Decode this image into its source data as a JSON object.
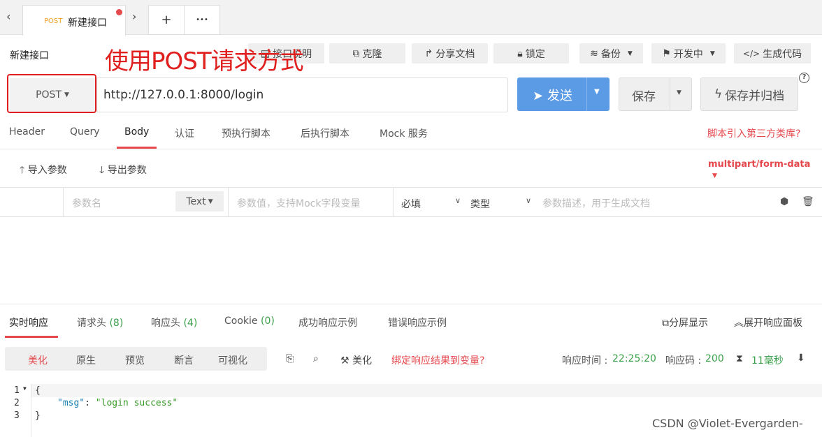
{
  "tabs": {
    "active": {
      "method": "POST",
      "title": "新建接口"
    },
    "add_label": "+",
    "more_label": "•••",
    "prev_label": "‹",
    "next_label": "›"
  },
  "toolbar": {
    "page_title": "新建接口",
    "doc_label": "接口说明",
    "clone_label": "克隆",
    "share_label": "分享文档",
    "lock_label": "锁定",
    "backup_label": "备份",
    "status_label": "开发中",
    "code_label": "生成代码"
  },
  "annotation": {
    "text": "使用POST请求方式",
    "color": "#e0201f"
  },
  "request": {
    "method": "POST",
    "url": "http://127.0.0.1:8000/login",
    "send_label": "发送",
    "save_label": "保存",
    "save_archive_label": "保存并归档",
    "help_label": "?"
  },
  "request_tabs": [
    "Header",
    "Query",
    "Body",
    "认证",
    "预执行脚本",
    "后执行脚本",
    "Mock 服务"
  ],
  "third_party_link": "脚本引入第三方类库?",
  "body": {
    "import_label": "导入参数",
    "export_label": "导出参数",
    "content_type": "multipart/form-data",
    "param": {
      "name_placeholder": "参数名",
      "type": "Text",
      "value_placeholder": "参数值，支持Mock字段变量",
      "required": "必填",
      "kind": "类型",
      "desc_placeholder": "参数描述，用于生成文档"
    }
  },
  "response_tabs": {
    "realtime": "实时响应",
    "req_headers": "请求头",
    "req_headers_count": "(8)",
    "res_headers": "响应头",
    "res_headers_count": "(4)",
    "cookie": "Cookie",
    "cookie_count": "(0)",
    "success_example": "成功响应示例",
    "error_example": "错误响应示例",
    "split_label": "分屏显示",
    "expand_label": "展开响应面板"
  },
  "format": {
    "items": [
      "美化",
      "原生",
      "预览",
      "断言",
      "可视化"
    ],
    "beautify_label": "美化",
    "bind_label": "绑定响应结果到变量?"
  },
  "stats": {
    "time_label": "响应时间 :",
    "time_value": "22:25:20",
    "code_label": "响应码 :",
    "code_value": "200",
    "duration": "11毫秒"
  },
  "code": {
    "lines": [
      "1",
      "2",
      "3"
    ],
    "l1": "{",
    "key": "\"msg\"",
    "colon": ": ",
    "value": "\"login success\"",
    "l3": "}"
  },
  "watermark": "CSDN @Violet-Evergarden-",
  "colors": {
    "accent": "#e5484d",
    "send": "#5b9be6",
    "success": "#3aa04a",
    "post": "#f0a020"
  }
}
